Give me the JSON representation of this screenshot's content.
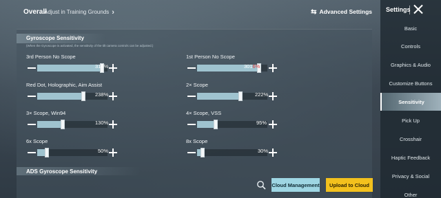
{
  "topbar": {
    "overall": "Overall",
    "adjust": "Adjust in Training Grounds",
    "advanced": "Advanced Settings"
  },
  "section": {
    "title": "Gyroscope Sensitivity",
    "note": "(When the Gyroscope is activated, the sensitivity of the tilt camera controls can be adjusted.)"
  },
  "sliders": [
    {
      "label": "3rd Person No Scope",
      "value": "314%",
      "fraction": 0.92
    },
    {
      "label": "1st Person No Scope",
      "value_main": "30",
      "value_prefix": "1",
      "value_red": "6%",
      "fraction": 0.88
    },
    {
      "label": "Red Dot, Holographic, Aim Assist",
      "value": "238%",
      "fraction": 0.66
    },
    {
      "label": "2× Scope",
      "value": "222%",
      "fraction": 0.62
    },
    {
      "label": "3× Scope, Win94",
      "value": "130%",
      "fraction": 0.36
    },
    {
      "label": "4× Scope, VSS",
      "value": "95%",
      "fraction": 0.26
    },
    {
      "label": "6x Scope",
      "value": "50%",
      "fraction": 0.14
    },
    {
      "label": "8x Scope",
      "value": "30%",
      "fraction": 0.08
    }
  ],
  "ads": {
    "title": "ADS Gyroscope Sensitivity"
  },
  "buttons": {
    "cloud": "Cloud Management",
    "upload": "Upload to Cloud"
  },
  "sidebar": {
    "title": "Settings",
    "items": [
      {
        "label": "Basic"
      },
      {
        "label": "Controls"
      },
      {
        "label": "Graphics & Audio"
      },
      {
        "label": "Customize Buttons"
      },
      {
        "label": "Sensitivity"
      },
      {
        "label": "Pick Up"
      },
      {
        "label": "Crosshair"
      },
      {
        "label": "Haptic Feedback"
      },
      {
        "label": "Privacy & Social"
      },
      {
        "label": "Other"
      }
    ],
    "active": "Sensitivity"
  },
  "colors": {
    "fill": "#9fc3cf",
    "cloud_button": "#9ed6e3",
    "upload_button": "#f3c11d",
    "highlight_red": "#e23b3b"
  }
}
